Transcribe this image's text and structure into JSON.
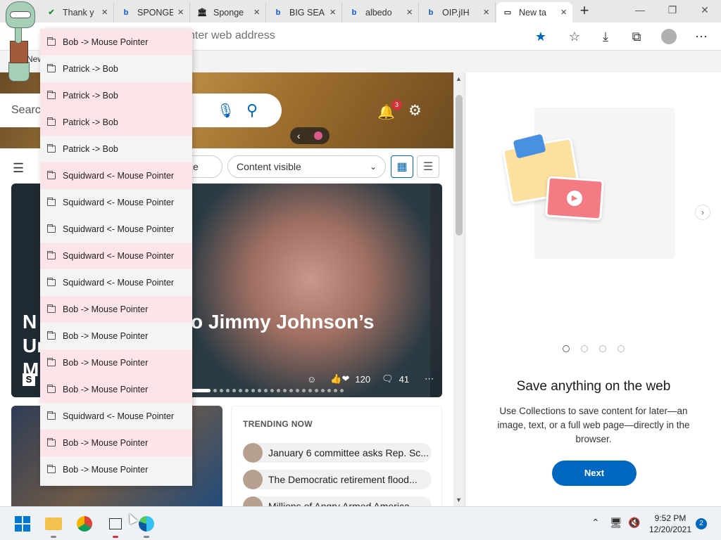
{
  "tabs": [
    {
      "title": "Thank y",
      "icon": "trello-check-icon",
      "icon_color": "#1a8a3a"
    },
    {
      "title": "SPONGE",
      "icon": "bing-icon",
      "icon_color": "#0a5ad4"
    },
    {
      "title": "Sponge",
      "icon": "museum-icon",
      "icon_color": "#222222"
    },
    {
      "title": "BIG SEA",
      "icon": "bing-icon",
      "icon_color": "#0a5ad4"
    },
    {
      "title": "albedo",
      "icon": "bing-icon",
      "icon_color": "#0a5ad4"
    },
    {
      "title": "OIP.jIH",
      "icon": "bing-icon",
      "icon_color": "#0a5ad4"
    },
    {
      "title": "New ta",
      "icon": "newtab-icon",
      "icon_color": "#333333"
    }
  ],
  "toolbar": {
    "address_placeholder": "nter web address",
    "favorites_star_color": "#0067c0"
  },
  "avatar_label": "New",
  "dropdown_items": [
    {
      "label": "Bob -> Mouse Pointer",
      "highlight": true
    },
    {
      "label": "Patrick -> Bob",
      "highlight": false
    },
    {
      "label": "Patrick -> Bob",
      "highlight": true
    },
    {
      "label": "Patrick -> Bob",
      "highlight": true
    },
    {
      "label": "Patrick -> Bob",
      "highlight": false
    },
    {
      "label": "Squidward <- Mouse Pointer",
      "highlight": true
    },
    {
      "label": "Squidward <- Mouse Pointer",
      "highlight": false
    },
    {
      "label": "Squidward <- Mouse Pointer",
      "highlight": false
    },
    {
      "label": "Squidward <- Mouse Pointer",
      "highlight": true
    },
    {
      "label": "Squidward <- Mouse Pointer",
      "highlight": false
    },
    {
      "label": "Bob -> Mouse Pointer",
      "highlight": true
    },
    {
      "label": "Bob -> Mouse Pointer",
      "highlight": false
    },
    {
      "label": "Bob -> Mouse Pointer",
      "highlight": true
    },
    {
      "label": "Bob -> Mouse Pointer",
      "highlight": true
    },
    {
      "label": "Squidward <- Mouse Pointer",
      "highlight": false
    },
    {
      "label": "Bob -> Mouse Pointer",
      "highlight": true
    },
    {
      "label": "Bob -> Mouse Pointer",
      "highlight": false
    }
  ],
  "feed": {
    "search_placeholder": "Search",
    "notification_count": "3",
    "personalize_label": "alize",
    "content_select_value": "Content visible",
    "headline": "N To Jimmy Johnson’s Urban M",
    "headline_line1": "N",
    "headline_line2": "M",
    "headline_main": "To Jimmy Johnson’s Urban",
    "source_logo": "S",
    "reactions_count": "120",
    "comments_count": "41",
    "trending_title": "TRENDING NOW",
    "trending": [
      {
        "title": "January 6 committee asks Rep. Sc..."
      },
      {
        "title": "The Democratic retirement flood..."
      },
      {
        "title": "Millions of Angry Armed America..."
      }
    ]
  },
  "collections": {
    "title": "Save anything on the web",
    "description": "Use Collections to save content for later—an image, text, or a full web page—directly in the browser.",
    "next_label": "Next"
  },
  "taskbar": {
    "time": "9:52 PM",
    "date": "12/20/2021",
    "notification_count": "2"
  }
}
